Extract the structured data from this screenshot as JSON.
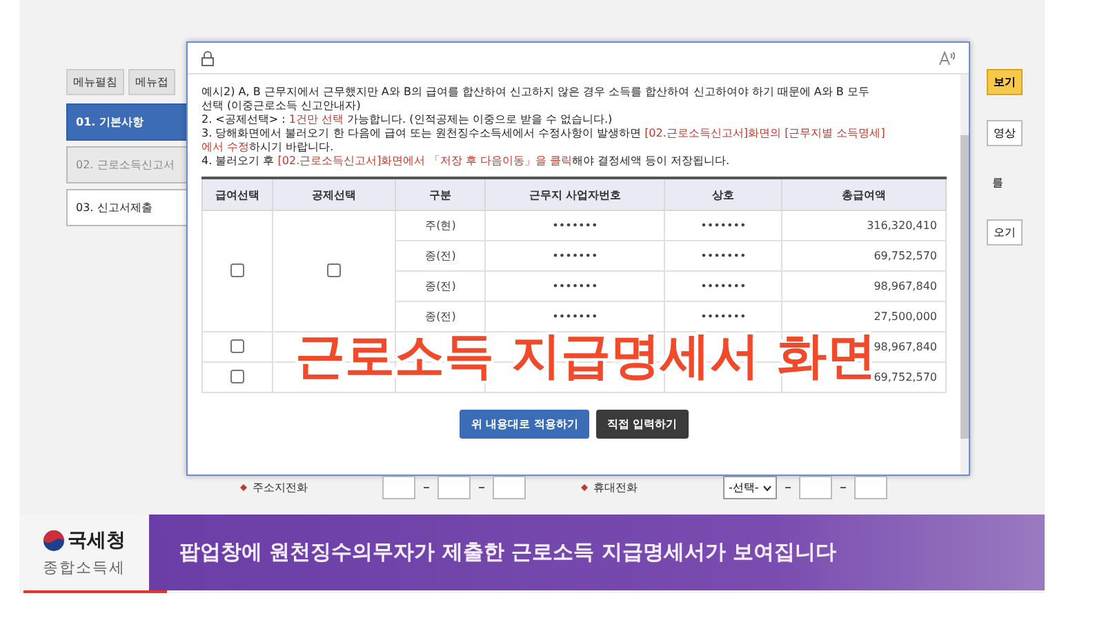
{
  "sidebar": {
    "buttons": [
      "메뉴펼침",
      "메뉴접"
    ],
    "steps": [
      {
        "label": "01. 기본사항",
        "selected": true,
        "disabled": false
      },
      {
        "label": "02. 근로소득신고서",
        "selected": false,
        "disabled": true
      },
      {
        "label": "03. 신고서제출",
        "selected": false,
        "disabled": false
      }
    ]
  },
  "right_column": [
    {
      "kind": "highlight",
      "text": "보기"
    },
    {
      "kind": "button",
      "text": "영상"
    },
    {
      "kind": "text",
      "text": "를"
    },
    {
      "kind": "button",
      "text": "오기"
    }
  ],
  "popup": {
    "notes": [
      [
        {
          "text": "예시2) A, B 근무지에서 근무했지만 A와 B의 급여를 합산하여 신고하지 않은 경우 소득를 합산하여 신고하여야 하기 때문에 A와 B 모두",
          "emphasis": false
        }
      ],
      [
        {
          "text": "선택 (이중근로소득 신고안내자)",
          "emphasis": false
        }
      ],
      [
        {
          "text": "2. <공제선택> : ",
          "emphasis": false
        },
        {
          "text": "1건만 선택",
          "emphasis": true
        },
        {
          "text": " 가능합니다. (인적공제는 이중으로 받을 수 없습니다.)",
          "emphasis": false
        }
      ],
      [
        {
          "text": "3. 당해화면에서 불러오기 한 다음에 급여 또는 원천징수소득세에서 수정사항이 발생하면 ",
          "emphasis": false
        },
        {
          "text": "[02.근로소득신고서]화면의 [근무지별 소득명세]",
          "emphasis": true
        }
      ],
      [
        {
          "text": "에서 수정",
          "emphasis": true
        },
        {
          "text": "하시기 바랍니다.",
          "emphasis": false
        }
      ],
      [
        {
          "text": "4. 불러오기 후 ",
          "emphasis": false
        },
        {
          "text": "[02.근로소득신고서]화면에서 「저장 후 다음이동」을 클릭",
          "emphasis": true
        },
        {
          "text": "해야 결정세액 등이 저장됩니다.",
          "emphasis": false
        }
      ]
    ],
    "table": {
      "columns": [
        "급여선택",
        "공제선택",
        "구분",
        "근무지 사업자번호",
        "상호",
        "총급여액"
      ],
      "groups": [
        {
          "salary_checked": false,
          "deduction_checked": false,
          "rows": [
            [
              "주(현)",
              "•••••••",
              "•••••••",
              "316,320,410"
            ],
            [
              "종(전)",
              "•••••••",
              "•••••••",
              "69,752,570"
            ],
            [
              "종(전)",
              "•••••••",
              "•••••••",
              "98,967,840"
            ],
            [
              "종(전)",
              "•••••••",
              "•••••••",
              "27,500,000"
            ]
          ]
        },
        {
          "salary_checked": false,
          "rows": [
            [
              null,
              null,
              null,
              "98,967,840"
            ]
          ]
        },
        {
          "salary_checked": false,
          "rows": [
            [
              null,
              null,
              null,
              "69,752,570"
            ]
          ]
        }
      ]
    },
    "buttons": [
      {
        "label": "위 내용대로 적용하기",
        "kind": "primary"
      },
      {
        "label": "직접 입력하기",
        "kind": "dark"
      }
    ]
  },
  "form": {
    "fields": [
      {
        "label": "주소지전화",
        "kind": "phone",
        "required": true
      },
      {
        "label": "휴대전화",
        "kind": "mobile",
        "select": "-선택-",
        "required": true
      }
    ]
  },
  "caption_overlay": "근로소득 지급명세서 화면",
  "banner": {
    "logo": "국세청",
    "subtitle": "종합소득세",
    "text": "팝업창에 원천징수의무자가 제출한 근로소득 지급명세서가 보여집니다"
  },
  "video_progress": {
    "level": 0.14
  }
}
